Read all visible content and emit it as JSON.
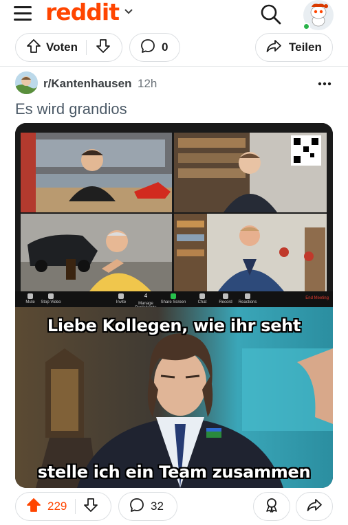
{
  "header": {
    "logo_text": "reddit",
    "brand_color": "#ff4500",
    "icons": [
      "menu-icon",
      "chevron-down-icon",
      "search-icon",
      "avatar"
    ]
  },
  "previous_post_actions": {
    "vote_label": "Voten",
    "comment_count": "0",
    "share_label": "Teilen"
  },
  "post": {
    "subreddit": "r/Kantenhausen",
    "time_ago": "12h",
    "title": "Es wird grandios",
    "media": {
      "zoom_toolbar": {
        "items": [
          "Mute",
          "Stop Video",
          "Invite",
          "Manage Participants",
          "Share Screen",
          "Chat",
          "Record",
          "Reactions"
        ],
        "participant_count": "4",
        "end_label": "End Meeting"
      },
      "meme_top_caption": "Liebe Kollegen, wie ihr seht",
      "meme_bottom_caption": "stelle ich ein Team zusammen"
    },
    "actions": {
      "upvotes": "229",
      "comments": "32"
    }
  }
}
